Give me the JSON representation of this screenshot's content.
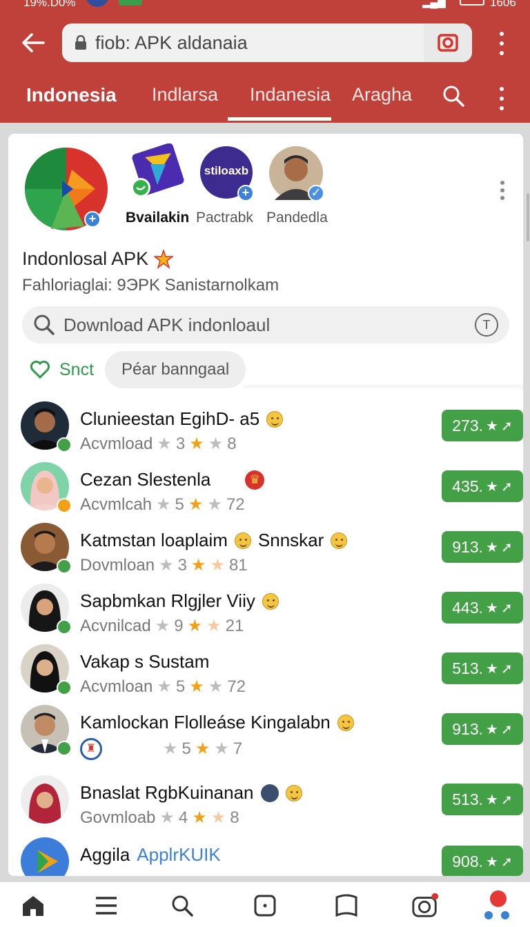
{
  "status_bar": {
    "battery_pct": "19%.D0%",
    "time": "1606"
  },
  "url_bar": {
    "text": "fiob: APK aldanaia"
  },
  "tabs": [
    {
      "label": "Indonesia",
      "active": false
    },
    {
      "label": "Indlarsa",
      "active": false
    },
    {
      "label": "Indanesia",
      "active": true
    },
    {
      "label": "Aragha",
      "active": false
    }
  ],
  "featured": [
    {
      "label": ""
    },
    {
      "label": "Bvailakin"
    },
    {
      "label": "Pactrabk"
    },
    {
      "label": "Pandedla"
    }
  ],
  "featured_logo_text": "stiloaxb",
  "section": {
    "title": "Indonlosal APK",
    "subtitle": "Fahloriaglai: 9ЭPK Sanistarnolkam"
  },
  "search": {
    "placeholder": "Download APK indonloaul",
    "badge": "T"
  },
  "chips": {
    "green_label": "Snct",
    "grey_label": "Péar banngaal"
  },
  "list": [
    {
      "title": "Clunieestan EgihD- a5",
      "meta": "Acvmload",
      "n1": "3",
      "n2": "8",
      "score": "273."
    },
    {
      "title": "Cezan Slestenla",
      "meta": "Acvmlcah",
      "n1": "5",
      "n2": "72",
      "score": "435."
    },
    {
      "title": "Katmstan loaplaim",
      "title2": "Snnskar",
      "meta": "Dovmloan",
      "n1": "3",
      "n2": "81",
      "score": "913."
    },
    {
      "title": "Sapbmkan Rlgjler Viiy",
      "meta": "Acvnilcad",
      "n1": "9",
      "n2": "21",
      "score": "443."
    },
    {
      "title": "Vakap s Sustam",
      "meta": "Acvmloan",
      "n1": "5",
      "n2": "72",
      "score": "513."
    },
    {
      "title": "Kamlockan Flolleáse Kingalabn",
      "meta": "",
      "n1": "5",
      "n2": "7",
      "score": "913."
    },
    {
      "title": "Bnaslat RgbKuinanan",
      "meta": "Govmloab",
      "n1": "4",
      "n2": "8",
      "score": "513."
    },
    {
      "title": "Aggila",
      "title2": "ApplrKUIK",
      "meta": "",
      "n1": "",
      "n2": "",
      "score": "908."
    }
  ],
  "colors": {
    "header": "#c0403a",
    "accent_green": "#43a047",
    "star_orange": "#f2a018"
  }
}
